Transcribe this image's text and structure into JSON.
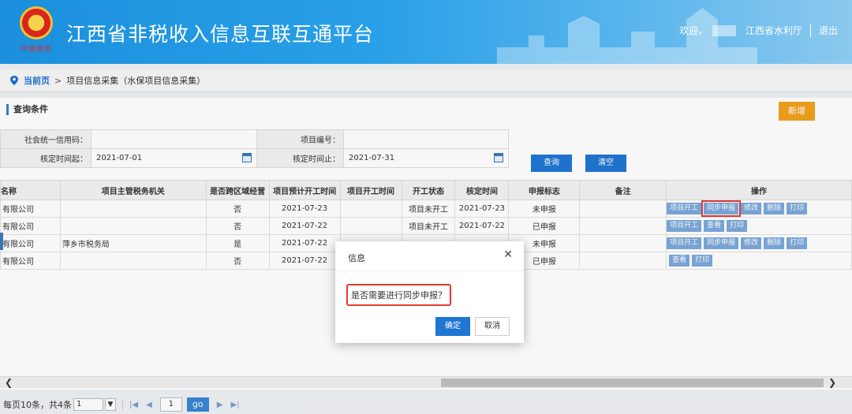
{
  "header": {
    "title": "江西省非税收入信息互联互通平台",
    "logo_text": "中国税务",
    "welcome": "欢迎，",
    "department": "江西省水利厅",
    "logout": "退出"
  },
  "breadcrumb": {
    "current": "当前页",
    "separator": ">",
    "path": "项目信息采集（水保项目信息采集）"
  },
  "query": {
    "header": "查询条件",
    "add_label": "新增",
    "credit_code_label": "社会统一信用码：",
    "credit_code_value": "",
    "project_no_label": "项目编号：",
    "project_no_value": "",
    "date_start_label": "核定时间起：",
    "date_start_value": "2021-07-01",
    "date_end_label": "核定时间止：",
    "date_end_value": "2021-07-31",
    "search_label": "查询",
    "clear_label": "清空"
  },
  "grid": {
    "columns": [
      "名称",
      "项目主管税务机关",
      "是否跨区域经营",
      "项目预计开工时间",
      "项目开工时间",
      "开工状态",
      "核定时间",
      "申报标志",
      "备注",
      "操作"
    ],
    "rows": [
      {
        "name": "有限公司",
        "tax_office": "",
        "cross_region": "否",
        "planned_start": "2021-07-23",
        "actual_start": "",
        "status": "项目未开工",
        "approved": "2021-07-23",
        "flag": "未申报",
        "note": "",
        "ops": [
          "项目开工",
          "同步申报",
          "修改",
          "删除",
          "打印"
        ]
      },
      {
        "name": "有限公司",
        "tax_office": "",
        "cross_region": "否",
        "planned_start": "2021-07-22",
        "actual_start": "",
        "status": "项目未开工",
        "approved": "2021-07-22",
        "flag": "已申报",
        "note": "",
        "ops": [
          "项目开工",
          "查看",
          "打印"
        ]
      },
      {
        "name": "有限公司",
        "tax_office": "萍乡市税务局",
        "cross_region": "是",
        "planned_start": "2021-07-22",
        "actual_start": "",
        "status": "",
        "approved": "",
        "flag": "未申报",
        "note": "",
        "ops": [
          "项目开工",
          "同步申报",
          "修改",
          "删除",
          "打印"
        ]
      },
      {
        "name": "有限公司",
        "tax_office": "",
        "cross_region": "否",
        "planned_start": "2021-07-22",
        "actual_start": "",
        "status": "",
        "approved": "",
        "flag": "已申报",
        "note": "",
        "ops": [
          "查看",
          "打印"
        ]
      }
    ]
  },
  "pager": {
    "summary": "每页10条，共4条",
    "page_size": "1",
    "page": "1",
    "go": "go"
  },
  "dialog": {
    "title": "信息",
    "close": "✕",
    "message": "是否需要进行同步申报？",
    "ok": "确定",
    "cancel": "取消"
  },
  "colors": {
    "primary": "#1f76d3",
    "accent": "#f0a21d",
    "highlight": "#e53935"
  }
}
